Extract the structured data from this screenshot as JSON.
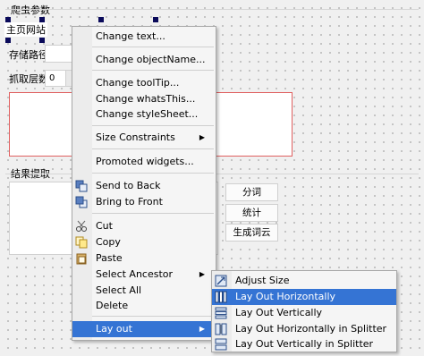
{
  "form": {
    "crawler_group_title": "爬虫参数",
    "homepage_label": "主页网站",
    "storage_label": "存储路径",
    "depth_label": "抓取层数",
    "depth_value": "0",
    "result_group_title": "结果提取",
    "buttons": [
      "分词",
      "统计",
      "生成词云"
    ]
  },
  "context_menu": {
    "items": [
      {
        "label": "Change text...",
        "icon": "",
        "submenu": false
      },
      {
        "sep": true
      },
      {
        "label": "Change objectName...",
        "icon": "",
        "submenu": false
      },
      {
        "sep": true
      },
      {
        "label": "Change toolTip...",
        "icon": "",
        "submenu": false
      },
      {
        "label": "Change whatsThis...",
        "icon": "",
        "submenu": false
      },
      {
        "label": "Change styleSheet...",
        "icon": "",
        "submenu": false
      },
      {
        "sep": true
      },
      {
        "label": "Size Constraints",
        "icon": "",
        "submenu": true
      },
      {
        "sep": true
      },
      {
        "label": "Promoted widgets...",
        "icon": "",
        "submenu": false
      },
      {
        "sep": true
      },
      {
        "label": "Send to Back",
        "icon": "send-to-back-icon",
        "submenu": false
      },
      {
        "label": "Bring to Front",
        "icon": "bring-to-front-icon",
        "submenu": false
      },
      {
        "sep": true
      },
      {
        "label": "Cut",
        "icon": "cut-icon",
        "submenu": false
      },
      {
        "label": "Copy",
        "icon": "copy-icon",
        "submenu": false
      },
      {
        "label": "Paste",
        "icon": "paste-icon",
        "submenu": false
      },
      {
        "label": "Select Ancestor",
        "icon": "",
        "submenu": true
      },
      {
        "label": "Select All",
        "icon": "",
        "submenu": false
      },
      {
        "label": "Delete",
        "icon": "",
        "submenu": false
      },
      {
        "sep": true
      },
      {
        "label": "Lay out",
        "icon": "",
        "submenu": true,
        "highlighted": true
      }
    ]
  },
  "layout_submenu": {
    "items": [
      {
        "label": "Adjust Size",
        "icon": "adjust-size-icon"
      },
      {
        "label": "Lay Out Horizontally",
        "icon": "layout-horizontal-icon",
        "highlighted": true
      },
      {
        "label": "Lay Out Vertically",
        "icon": "layout-vertical-icon"
      },
      {
        "label": "Lay Out Horizontally in Splitter",
        "icon": "splitter-horizontal-icon"
      },
      {
        "label": "Lay Out Vertically in Splitter",
        "icon": "splitter-vertical-icon"
      }
    ]
  },
  "colors": {
    "highlight": "#3574d4",
    "selection_handle": "#0a0a5a",
    "red_border": "#e06060"
  }
}
